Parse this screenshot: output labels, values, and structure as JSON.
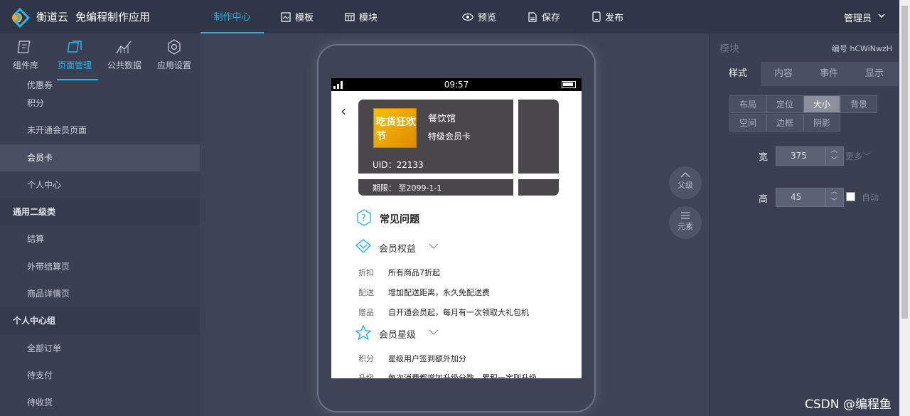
{
  "topbar": {
    "brand": "衡道云",
    "brand_sub": "免编程制作应用",
    "nav": [
      {
        "label": "制作中心",
        "active": true
      },
      {
        "label": "模板"
      },
      {
        "label": "模块"
      },
      {
        "label": "预览"
      },
      {
        "label": "保存"
      },
      {
        "label": "发布"
      }
    ],
    "admin": "管理员"
  },
  "sidebar": {
    "tabs": [
      "组件库",
      "页面管理",
      "公共数据",
      "应用设置"
    ],
    "active_tab": "页面管理",
    "items": [
      {
        "label": "优惠券",
        "type": "item"
      },
      {
        "label": "积分",
        "type": "item"
      },
      {
        "label": "未开通会员页面",
        "type": "item"
      },
      {
        "label": "会员卡",
        "type": "item",
        "active": true
      },
      {
        "label": "个人中心",
        "type": "item"
      },
      {
        "label": "通用二级类",
        "type": "group"
      },
      {
        "label": "结算",
        "type": "item"
      },
      {
        "label": "外带结算页",
        "type": "item"
      },
      {
        "label": "商品详情页",
        "type": "item"
      },
      {
        "label": "个人中心组",
        "type": "group"
      },
      {
        "label": "全部订单",
        "type": "item"
      },
      {
        "label": "待支付",
        "type": "item"
      },
      {
        "label": "待收货",
        "type": "item"
      }
    ]
  },
  "phone": {
    "time": "09:57",
    "shop_name": "餐饮馆",
    "card_level": "特级会员卡",
    "uid": "UID：22133",
    "expire": "期限： 至2099-1-1",
    "thumb_text": "吃货狂欢节",
    "faq_title": "常见问题",
    "sections": [
      {
        "title": "会员权益",
        "rows": [
          {
            "label": "折扣",
            "text": "所有商品7折起"
          },
          {
            "label": "配送",
            "text": "增加配送距离，永久免配送费"
          },
          {
            "label": "赠品",
            "text": "自开通会员起，每月有一次领取大礼包机"
          }
        ]
      },
      {
        "title": "会员星级",
        "rows": [
          {
            "label": "积分",
            "text": "星级用户签到额外加分"
          },
          {
            "label": "升级",
            "text": "每次消费都增加升级分数，累积一定则升级"
          }
        ]
      }
    ]
  },
  "float_buttons": [
    "父级",
    "元素"
  ],
  "rpanel": {
    "title": "模块",
    "id_label": "编号 hCWiNwzH",
    "tabs": [
      "样式",
      "内容",
      "事件",
      "显示"
    ],
    "active_tab": "样式",
    "segments": [
      "布局",
      "定位",
      "大小",
      "背景",
      "空间",
      "边框",
      "阴影"
    ],
    "active_segment": "大小",
    "width_label": "宽",
    "width_value": "375",
    "more": "更多",
    "height_label": "高",
    "height_value": "45",
    "auto": "自动"
  },
  "watermark": "CSDN @编程鱼",
  "colors": {
    "accent": "#2ab4e8",
    "topbar": "#2f3647",
    "sidebar": "#3a4052",
    "canvas": "#3e4456"
  }
}
